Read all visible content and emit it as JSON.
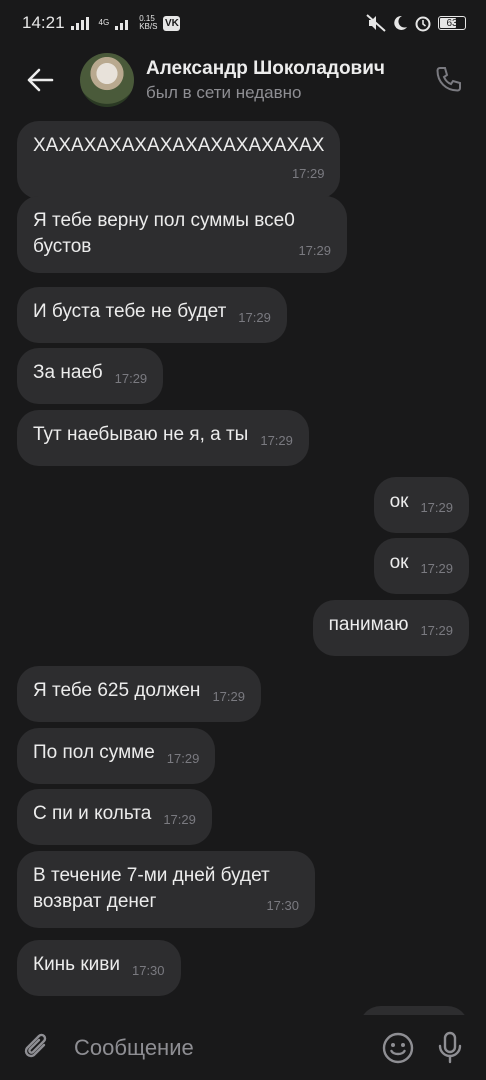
{
  "status_bar": {
    "time": "14:21",
    "network_top": "4G",
    "speed_value": "0.15",
    "speed_unit": "KB/S",
    "vk_icon_label": "VK",
    "battery": "63"
  },
  "header": {
    "name": "Александр Шоколадович",
    "status": "был в сети недавно",
    "icons": {
      "back": "arrow-left-icon",
      "call": "phone-icon"
    }
  },
  "messages": [
    {
      "side": "in",
      "text": "ХАХАХАХАХАХАХАХАХАХАХАХ",
      "time": "17:29"
    },
    {
      "side": "in",
      "text": "Я тебе верну пол суммы все0 бустов",
      "time": "17:29"
    },
    {
      "side": "in",
      "text": "И буста тебе не будет",
      "time": "17:29"
    },
    {
      "side": "in",
      "text": "За наеб",
      "time": "17:29"
    },
    {
      "side": "in",
      "text": "Тут наебываю не я, а ты",
      "time": "17:29"
    },
    {
      "side": "out",
      "text": "ок",
      "time": "17:29"
    },
    {
      "side": "out",
      "text": "ок",
      "time": "17:29"
    },
    {
      "side": "out",
      "text": "панимаю",
      "time": "17:29"
    },
    {
      "side": "in",
      "text": "Я тебе 625 должен",
      "time": "17:29"
    },
    {
      "side": "in",
      "text": "По пол сумме",
      "time": "17:29"
    },
    {
      "side": "in",
      "text": "С пи и кольта",
      "time": "17:29"
    },
    {
      "side": "in",
      "text": "В течение 7-ми дней будет возврат денег",
      "time": "17:30"
    },
    {
      "side": "in",
      "text": "Кинь киви",
      "time": "17:30"
    }
  ],
  "composer": {
    "placeholder": "Сообщение",
    "icons": {
      "attach": "paperclip-icon",
      "emoji": "smiley-icon",
      "mic": "microphone-icon"
    }
  },
  "colors": {
    "background": "#19191a",
    "bubble": "#2d2d2f",
    "text": "#ececec",
    "muted": "#8e8e93"
  }
}
